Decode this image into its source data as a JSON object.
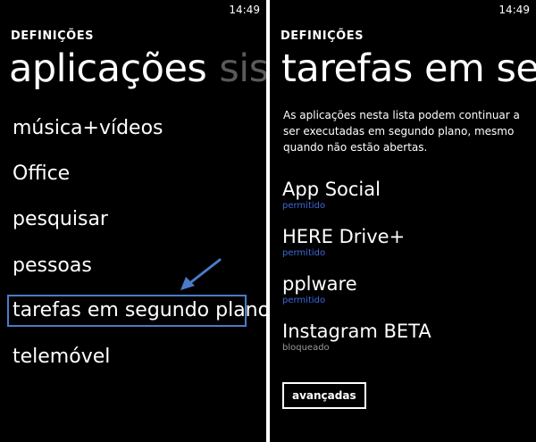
{
  "left": {
    "clock": "14:49",
    "app_title": "DEFINIÇÕES",
    "pivot_active": "aplicações",
    "pivot_next": "sistema",
    "menu": [
      {
        "label": "música+vídeos"
      },
      {
        "label": "Office"
      },
      {
        "label": "pesquisar"
      },
      {
        "label": "pessoas"
      },
      {
        "label": "tarefas em segundo plano"
      },
      {
        "label": "telemóvel"
      }
    ]
  },
  "right": {
    "clock": "14:49",
    "app_title": "DEFINIÇÕES",
    "page_title": "tarefas em segundo plano",
    "description": "As aplicações nesta lista podem continuar a ser executadas em segundo plano, mesmo quando não estão abertas.",
    "apps": [
      {
        "name": "App Social",
        "status": "permitido"
      },
      {
        "name": "HERE Drive+",
        "status": "permitido"
      },
      {
        "name": "pplware",
        "status": "permitido"
      },
      {
        "name": "Instagram BETA",
        "status": "bloqueado"
      }
    ],
    "advanced_button": "avançadas"
  },
  "colors": {
    "accent": "#3d67d9",
    "highlight": "#4a7bc8",
    "muted": "#9a9a9a",
    "background": "#000000",
    "divider": "#ffffff"
  }
}
